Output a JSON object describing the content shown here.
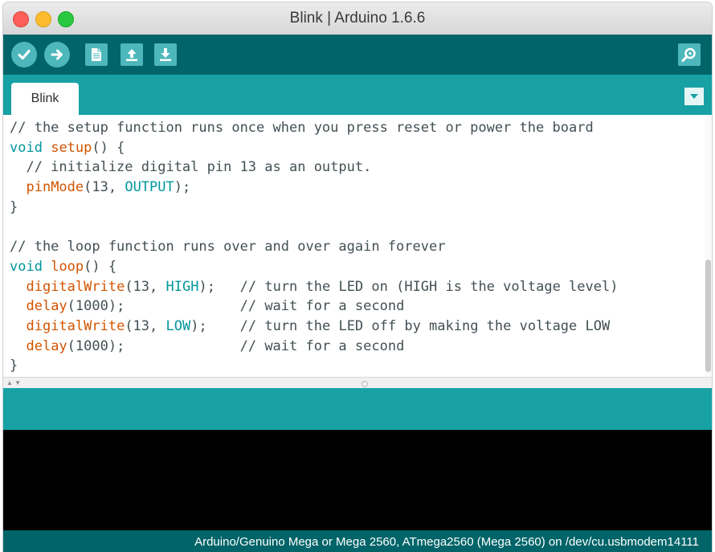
{
  "window": {
    "title": "Blink | Arduino 1.6.6"
  },
  "toolbar": {
    "buttons": [
      {
        "name": "verify",
        "icon": "checkmark-icon"
      },
      {
        "name": "upload",
        "icon": "right-arrow-icon"
      },
      {
        "name": "new",
        "icon": "new-document-icon"
      },
      {
        "name": "open",
        "icon": "up-arrow-icon"
      },
      {
        "name": "save",
        "icon": "down-arrow-icon"
      },
      {
        "name": "serial-monitor",
        "icon": "magnifier-icon"
      }
    ]
  },
  "tabs": [
    {
      "label": "Blink",
      "active": true
    }
  ],
  "editor": {
    "lines": [
      [
        {
          "t": "// the setup function runs once when you press reset or power the board",
          "c": "cm"
        }
      ],
      [
        {
          "t": "void",
          "c": "kw"
        },
        {
          "t": " "
        },
        {
          "t": "setup",
          "c": "fn"
        },
        {
          "t": "() {"
        }
      ],
      [
        {
          "t": "  // initialize digital pin 13 as an output.",
          "c": "cm"
        }
      ],
      [
        {
          "t": "  "
        },
        {
          "t": "pinMode",
          "c": "fn"
        },
        {
          "t": "(13, "
        },
        {
          "t": "OUTPUT",
          "c": "kw"
        },
        {
          "t": ");"
        }
      ],
      [
        {
          "t": "}"
        }
      ],
      [
        {
          "t": ""
        }
      ],
      [
        {
          "t": "// the loop function runs over and over again forever",
          "c": "cm"
        }
      ],
      [
        {
          "t": "void",
          "c": "kw"
        },
        {
          "t": " "
        },
        {
          "t": "loop",
          "c": "fn"
        },
        {
          "t": "() {"
        }
      ],
      [
        {
          "t": "  "
        },
        {
          "t": "digitalWrite",
          "c": "fn"
        },
        {
          "t": "(13, "
        },
        {
          "t": "HIGH",
          "c": "kw"
        },
        {
          "t": ");   "
        },
        {
          "t": "// turn the LED on (HIGH is the voltage level)",
          "c": "cm"
        }
      ],
      [
        {
          "t": "  "
        },
        {
          "t": "delay",
          "c": "fn"
        },
        {
          "t": "(1000);              "
        },
        {
          "t": "// wait for a second",
          "c": "cm"
        }
      ],
      [
        {
          "t": "  "
        },
        {
          "t": "digitalWrite",
          "c": "fn"
        },
        {
          "t": "(13, "
        },
        {
          "t": "LOW",
          "c": "kw"
        },
        {
          "t": ");    "
        },
        {
          "t": "// turn the LED off by making the voltage LOW",
          "c": "cm"
        }
      ],
      [
        {
          "t": "  "
        },
        {
          "t": "delay",
          "c": "fn"
        },
        {
          "t": "(1000);              "
        },
        {
          "t": "// wait for a second",
          "c": "cm"
        }
      ],
      [
        {
          "t": "}"
        }
      ]
    ]
  },
  "status": {
    "board": "Arduino/Genuino Mega or Mega 2560, ATmega2560 (Mega 2560) on /dev/cu.usbmodem14111"
  },
  "colors": {
    "toolbar_bg": "#006468",
    "tabbar_bg": "#17a1a5",
    "button_bg": "#4db7bb",
    "keyword": "#00979c",
    "function": "#d35400",
    "text": "#434f54",
    "console_bg": "#000000"
  }
}
